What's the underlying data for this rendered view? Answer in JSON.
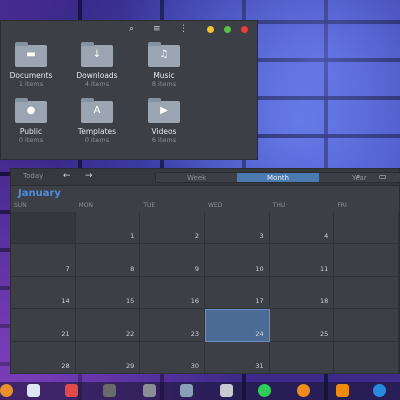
{
  "file_manager": {
    "folders": [
      {
        "name": "Documents",
        "count": "1 items",
        "glyph": "▬"
      },
      {
        "name": "Downloads",
        "count": "4 items",
        "glyph": "↓"
      },
      {
        "name": "Music",
        "count": "8 items",
        "glyph": "♫"
      },
      {
        "name": "Public",
        "count": "0 items",
        "glyph": "●"
      },
      {
        "name": "Templates",
        "count": "0 items",
        "glyph": "A"
      },
      {
        "name": "Videos",
        "count": "6 items",
        "glyph": "▶"
      }
    ],
    "window_controls": {
      "minimize_color": "#f4c430",
      "maximize_color": "#58c142",
      "close_color": "#ef3b3b"
    }
  },
  "calendar": {
    "today_label": "Today",
    "views": [
      "Week",
      "Month",
      "Year"
    ],
    "active_view": "Month",
    "month": "January",
    "weekdays": [
      "SUN",
      "MON",
      "TUE",
      "WED",
      "THU",
      "FRI"
    ],
    "weeks": [
      [
        "",
        "1",
        "2",
        "3",
        "4",
        ""
      ],
      [
        "7",
        "8",
        "9",
        "10",
        "11",
        ""
      ],
      [
        "14",
        "15",
        "16",
        "17",
        "18",
        ""
      ],
      [
        "21",
        "22",
        "23",
        "24",
        "25",
        ""
      ],
      [
        "28",
        "29",
        "30",
        "31",
        "",
        ""
      ]
    ],
    "selected_day": "24"
  },
  "dock": {
    "icons": [
      {
        "name": "firefox-icon",
        "color": "#e8902a"
      },
      {
        "name": "files-icon",
        "color": "#dfe7f2"
      },
      {
        "name": "text-editor-icon",
        "color": "#e24a4a"
      },
      {
        "name": "tweaks-icon",
        "color": "#6a6a6a"
      },
      {
        "name": "calculator-icon",
        "color": "#8a8f96"
      },
      {
        "name": "screenshot-icon",
        "color": "#8aa0b8"
      },
      {
        "name": "drive-icon",
        "color": "#c8ccd2"
      },
      {
        "name": "spotify-icon",
        "color": "#2ecc5a"
      },
      {
        "name": "backup-icon",
        "color": "#f08a1a"
      },
      {
        "name": "vlc-icon",
        "color": "#f08a10"
      },
      {
        "name": "download-icon",
        "color": "#2a8ae0"
      }
    ]
  }
}
